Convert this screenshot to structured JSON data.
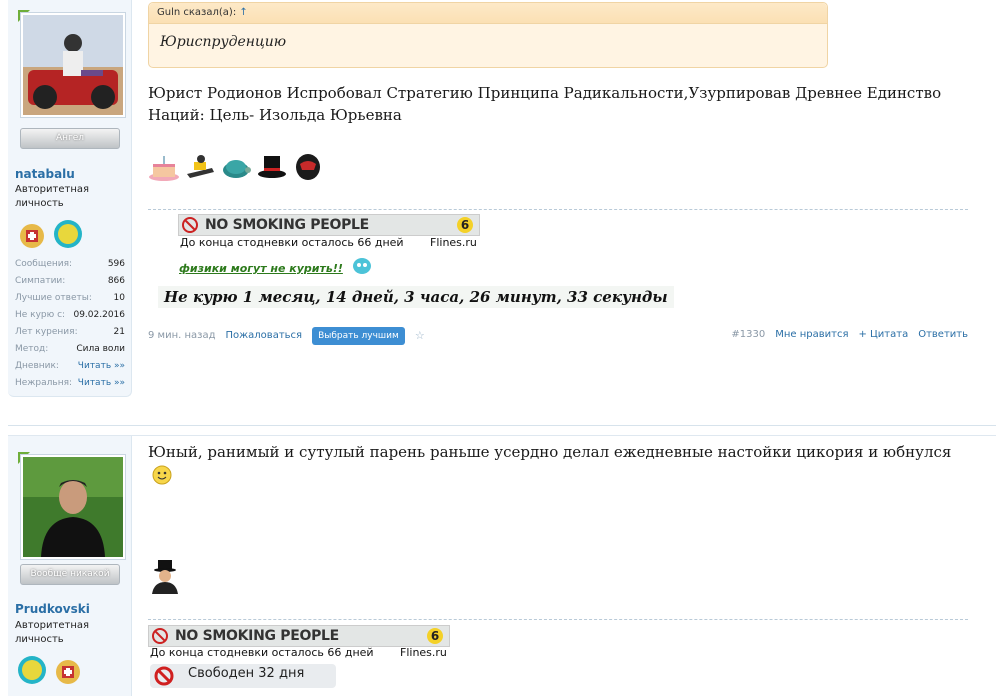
{
  "post1": {
    "user": {
      "name": "natabalu",
      "title": "Авторитетная личность",
      "rank": "Ангел",
      "stats": [
        {
          "key": "Сообщения:",
          "value": "596"
        },
        {
          "key": "Симпатии:",
          "value": "866"
        },
        {
          "key": "Лучшие ответы:",
          "value": "10"
        },
        {
          "key": "Не курю с:",
          "value": "09.02.2016"
        },
        {
          "key": "Лет курения:",
          "value": "21"
        },
        {
          "key": "Метод:",
          "value": "Сила воли"
        },
        {
          "key": "Дневник:",
          "value": "Читать »»"
        },
        {
          "key": "Нежральня:",
          "value": "Читать »»"
        }
      ]
    },
    "quote": {
      "author": "Guln сказал(а):",
      "arrow": "↑",
      "text": "Юриспруденцию"
    },
    "message": "Юрист Родионов Испробовал Стратегию Принципа Радикальности,Узурпировав Древнее Единство Наций: Цель- Изольда Юрьевна",
    "smiles": [
      "cake-icon",
      "snowmobile-icon",
      "turtle-icon",
      "top-hat-icon",
      "helmet-icon"
    ],
    "signature": {
      "banner_title": "NO SMOKING PEOPLE",
      "banner_number": "6",
      "days_left": "До конца стодневки осталось 66 дней",
      "site": "Flines.ru",
      "physics_link": "физики могут не курить!!",
      "timer": "Не курю 1 месяц, 14 дней, 3 часа, 26 минут, 33 секунды"
    },
    "meta": {
      "time": "9 мин. назад",
      "report": "Пожаловаться",
      "best": "Выбрать лучшим",
      "star": "☆",
      "number": "#1330",
      "dislike": "Мне нравится",
      "quote": "+ Цитата",
      "reply": "Ответить"
    }
  },
  "post2": {
    "user": {
      "name": "Prudkovski",
      "title": "Авторитетная личность",
      "rank": "Вообще никакой"
    },
    "message": "Юный, ранимый и сутулый парень раньше усердно делал ежедневные настойки цикория и юбнулся",
    "signature": {
      "banner_title": "NO SMOKING PEOPLE",
      "banner_number": "6",
      "days_left": "До конца стодневки осталось 66 дней",
      "site": "Flines.ru",
      "free": "Свободен 32 дня"
    }
  }
}
